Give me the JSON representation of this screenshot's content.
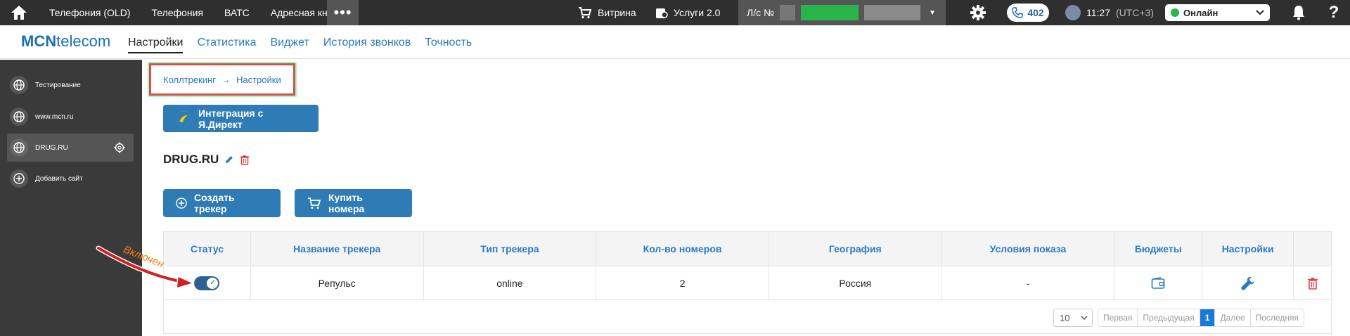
{
  "topbar": {
    "nav": [
      "Телефония (OLD)",
      "Телефония",
      "ВАТС",
      "Адресная книга"
    ],
    "more": "•••",
    "shop": "Витрина",
    "services": "Услуги 2.0",
    "account_label": "Л/с №",
    "calls_count": "402",
    "time": "11:27",
    "timezone": "(UTC+3)",
    "status": "Онлайн",
    "help": "?"
  },
  "subnav": {
    "logo_bold": "MCN",
    "logo_rest": "telecom",
    "tabs": [
      "Настройки",
      "Статистика",
      "Виджет",
      "История звонков",
      "Точность"
    ]
  },
  "sidebar": {
    "items": [
      "Тестирование",
      "www.mcn.ru",
      "DRUG.RU",
      "Добавить сайт"
    ]
  },
  "breadcrumb": {
    "parent": "Коллтрекинг",
    "arrow": "→",
    "current": "Настройки"
  },
  "buttons": {
    "direct": "Интеграция с Я.Директ",
    "create": "Создать трекер",
    "buy": "Купить номера"
  },
  "site": {
    "title": "DRUG.RU"
  },
  "table": {
    "headers": [
      "Статус",
      "Название трекера",
      "Тип трекера",
      "Кол-во номеров",
      "География",
      "Условия показа",
      "Бюджеты",
      "Настройки"
    ],
    "row": {
      "name": "Репульс",
      "type": "online",
      "count": "2",
      "geo": "Россия",
      "conditions": "-"
    }
  },
  "pager": {
    "page_size": "10",
    "first": "Первая",
    "prev": "Предыдущая",
    "current": "1",
    "next": "Далее",
    "last": "Последняя"
  },
  "annotation": "Включен",
  "colors": {
    "accent": "#2e7bb5",
    "topbar": "#2f2f2f",
    "sidebar": "#3a3a3a",
    "online": "#2ab54a",
    "delete": "#e04040",
    "annotation": "#ff7a1a"
  }
}
